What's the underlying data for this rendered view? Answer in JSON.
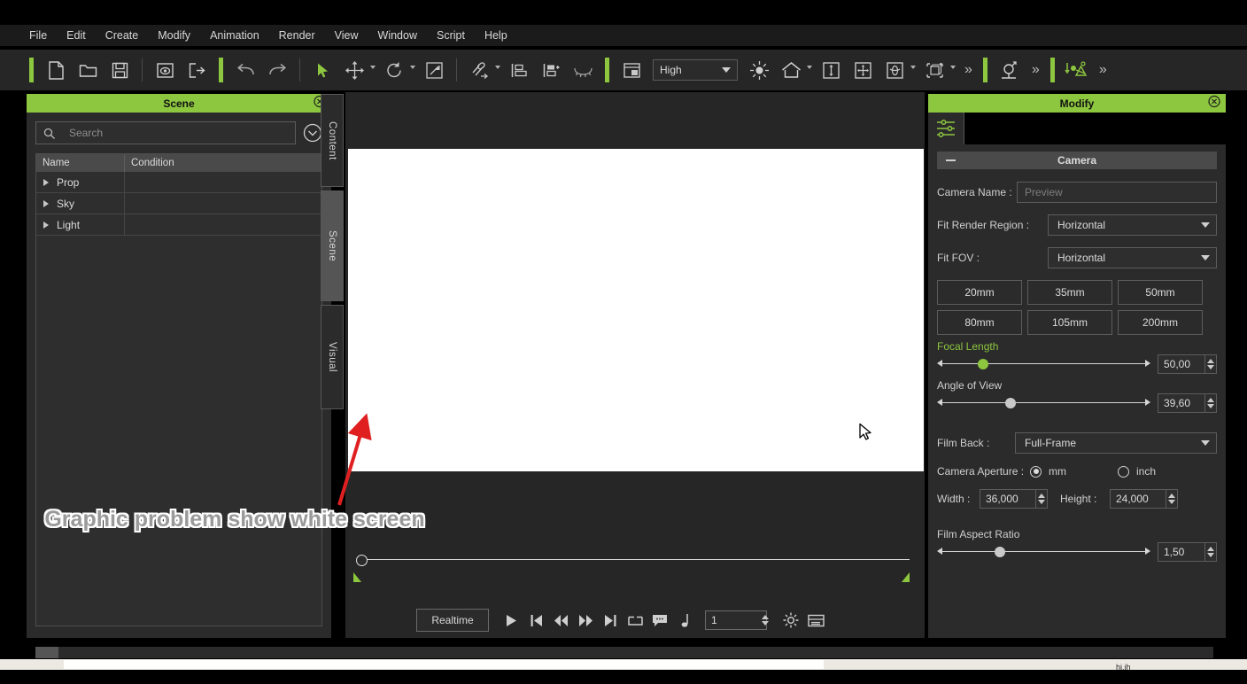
{
  "app": {
    "bottom_note": "hi.ih"
  },
  "menu": {
    "items": [
      {
        "label": "File"
      },
      {
        "label": "Edit"
      },
      {
        "label": "Create"
      },
      {
        "label": "Modify"
      },
      {
        "label": "Animation"
      },
      {
        "label": "Render"
      },
      {
        "label": "View"
      },
      {
        "label": "Window"
      },
      {
        "label": "Script"
      },
      {
        "label": "Help"
      }
    ]
  },
  "toolbar": {
    "quality": {
      "value": "High"
    },
    "icons": [
      "new-file-icon",
      "open-folder-icon",
      "save-icon",
      "preview-icon",
      "export-icon",
      "undo-icon",
      "redo-icon",
      "select-cursor-icon",
      "move-tool-icon",
      "rotate-tool-icon",
      "scale-tool-icon",
      "link-tool-icon",
      "align-left-icon",
      "align-right-icon",
      "eyelash-icon",
      "layout-icon",
      "light-icon",
      "home-icon",
      "vertical-fit-icon",
      "pan-icon",
      "orbit-icon",
      "transform-box-icon",
      "overflow-chevron-icon",
      "character-icon",
      "animation-icon"
    ],
    "overflow_label": "»"
  },
  "scene_panel": {
    "title": "Scene",
    "close_icon": "close-icon",
    "search": {
      "placeholder": "Search",
      "value": ""
    },
    "expand_icon": "chevron-down-circle-icon",
    "columns": [
      "Name",
      "Condition"
    ],
    "rows": [
      {
        "name": "Prop",
        "condition": ""
      },
      {
        "name": "Sky",
        "condition": ""
      },
      {
        "name": "Light",
        "condition": ""
      }
    ]
  },
  "vertical_tabs": [
    {
      "label": "Content",
      "active": false
    },
    {
      "label": "Scene",
      "active": true
    },
    {
      "label": "Visual",
      "active": false
    }
  ],
  "timeline": {
    "realtime_label": "Realtime",
    "frame_value": "1",
    "transport_icons": [
      "play-icon",
      "skip-start-icon",
      "rewind-icon",
      "fast-forward-icon",
      "skip-end-icon",
      "loop-range-icon",
      "comment-icon",
      "music-note-icon",
      "settings-gear-icon",
      "timeline-list-icon"
    ]
  },
  "modify_panel": {
    "title": "Modify",
    "close_icon": "close-icon",
    "tab_icon": "sliders-icon",
    "section": {
      "title": "Camera",
      "collapse_icon": "minus-icon"
    },
    "camera_name": {
      "label": "Camera Name :",
      "placeholder": "Preview",
      "value": ""
    },
    "fit_render_region": {
      "label": "Fit Render Region :",
      "value": "Horizontal"
    },
    "fit_fov": {
      "label": "Fit FOV :",
      "value": "Horizontal"
    },
    "focal_presets": [
      "20mm",
      "35mm",
      "50mm",
      "80mm",
      "105mm",
      "200mm"
    ],
    "focal_length": {
      "label": "Focal Length",
      "value": "50,00",
      "slider_pct": 19
    },
    "angle_of_view": {
      "label": "Angle of View",
      "value": "39,60",
      "slider_pct": 32
    },
    "film_back": {
      "label": "Film Back :",
      "value": "Full-Frame"
    },
    "camera_aperture": {
      "label": "Camera Aperture :",
      "options": [
        {
          "label": "mm",
          "selected": true
        },
        {
          "label": "inch",
          "selected": false
        }
      ]
    },
    "width": {
      "label": "Width :",
      "value": "36,000"
    },
    "height": {
      "label": "Height :",
      "value": "24,000"
    },
    "film_aspect_ratio": {
      "label": "Film Aspect Ratio",
      "value": "1,50",
      "slider_pct": 27
    }
  },
  "annotation": {
    "text": "Graphic problem show white screen",
    "color": "#9a9a9a",
    "arrow_color": "#e02020"
  },
  "colors": {
    "accent_green": "#8dc63f",
    "panel_bg": "#2b2b2b",
    "toolbar_bg": "#262626",
    "menubar_bg": "#1b1b1b"
  }
}
